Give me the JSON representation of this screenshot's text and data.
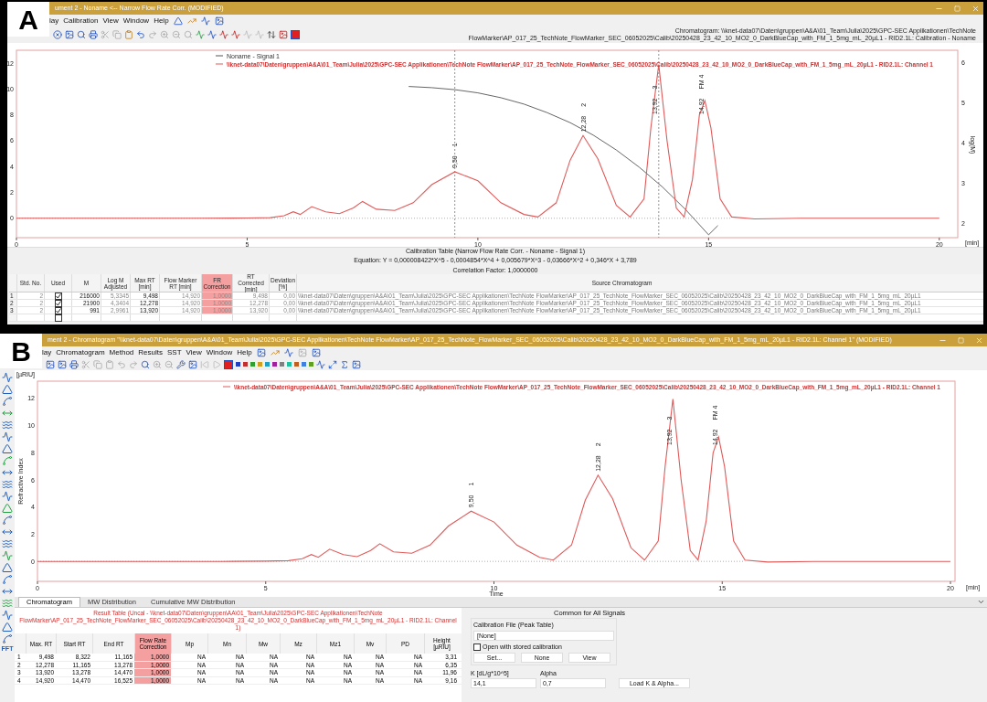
{
  "panel_a": {
    "label": "A",
    "title": "ument 2 -    Noname <-- Narrow Flow Rate Corr.  (MODIFIED)",
    "menu": [
      "lay",
      "Calibration",
      "View",
      "Window",
      "Help"
    ],
    "chart_caption": "Chromatogram: \\\\knet-data07\\Daten\\gruppen\\A&A\\01_Team\\Julia\\2025\\GPC-SEC Applikationen\\TechNote FlowMarker\\AP_017_25_TechNote_FlowMarker_SEC_06052025\\Calib\\20250428_23_42_10_MO2_0_DarkBlueCap_with_FM_1_5mg_mL_20µL1 - RID2.1L: Calibration - Noname",
    "chart_data": {
      "type": "line",
      "xlim": [
        0,
        20.4
      ],
      "ylim": [
        -1.5,
        13
      ],
      "y2lim": [
        1.65,
        6.31
      ],
      "xlabel": "[min]",
      "y2label": "log(M)",
      "xticks": [
        0,
        5,
        10,
        15,
        20
      ],
      "yticks": [
        0,
        2,
        4,
        6,
        8,
        10,
        12
      ],
      "y2ticks": [
        2,
        3,
        4,
        5,
        6
      ],
      "series": [
        {
          "name": "Noname - Signal 1",
          "color": "#555555",
          "axis": "y2",
          "x": [
            8.5,
            9,
            9.5,
            10,
            10.5,
            11,
            11.5,
            12,
            12.5,
            13,
            13.5,
            14,
            14.5,
            15,
            15.2
          ],
          "values": [
            5.41,
            5.38,
            5.33,
            5.25,
            5.13,
            4.97,
            4.76,
            4.51,
            4.2,
            3.83,
            3.4,
            2.91,
            2.35,
            1.72,
            1.95
          ]
        },
        {
          "name": "\\\\knet-data07\\Daten\\gruppen\\A&A\\01_Team\\Julia\\2025\\GPC-SEC Applikationen\\TechNote FlowMarker\\AP_017_25_TechNote_FlowMarker_SEC_06052025\\Calib\\20250428_23_42_10_MO2_0_DarkBlueCap_with_FM_1_5mg_mL_20µL1 - RID2.1L: Channel 1",
          "color": "#e05a5a",
          "x": [
            0,
            1,
            2,
            3,
            4,
            5,
            5.5,
            5.8,
            6,
            6.15,
            6.4,
            6.7,
            7,
            7.3,
            7.5,
            7.8,
            8.2,
            8.6,
            9,
            9.5,
            10,
            10.5,
            11,
            11.3,
            11.7,
            12,
            12.28,
            12.6,
            13,
            13.3,
            13.6,
            13.75,
            13.92,
            14.1,
            14.3,
            14.47,
            14.65,
            14.8,
            14.92,
            15.05,
            15.25,
            15.5,
            16,
            17,
            18,
            19,
            20
          ],
          "values": [
            0,
            0,
            0,
            0,
            0,
            0.02,
            0.05,
            0.2,
            0.5,
            0.3,
            0.9,
            0.5,
            0.35,
            0.8,
            1.3,
            0.7,
            0.6,
            1.2,
            2.6,
            3.6,
            2.9,
            1.2,
            0.3,
            0.1,
            1.2,
            4.5,
            6.4,
            4.6,
            1,
            0.1,
            1.5,
            7,
            11.9,
            6,
            0.8,
            0.1,
            3,
            8,
            9.1,
            7,
            1.5,
            0.1,
            -0.05,
            0,
            0,
            0,
            0
          ]
        }
      ],
      "annotations": [
        "9,50",
        "1",
        "12,28",
        "2",
        "13,92",
        "3",
        "14,92",
        "FM 4"
      ],
      "legend": "upper center",
      "ref_lines": [
        {
          "axis": "x",
          "value": 9.5
        },
        {
          "axis": "x",
          "value": 13.92
        }
      ]
    },
    "calibration": {
      "title": "Calibration Table (Narrow Flow Rate Corr. - Noname - Signal 1)",
      "equation": "Equation: Y = 0,000008422*X^5 - 0,0004854*X^4 + 0,005679*X^3 - 0,03666*X^2 + 0,346*X + 3,789",
      "correlation": "Correlation Factor: 1,0000000"
    },
    "table": {
      "columns": [
        "Std. No.",
        "Used",
        "M",
        "Log M Adjusted",
        "Max RT [min]",
        "Flow Marker RT [min]",
        "FR Correction",
        "RT Corrected [min]",
        "Deviation [%]",
        "Source Chromatogram"
      ],
      "rows": [
        {
          "index": "1",
          "std_no": "2",
          "used": true,
          "m": "216000",
          "log_m": "5,3345",
          "max_rt": "9,498",
          "fm_rt": "14,920",
          "fr": "1,0000",
          "rt_corr": "9,498",
          "dev": "0,00",
          "source": "\\\\knet-data07\\Daten\\gruppen\\A&A\\01_Team\\Julia\\2025\\GPC-SEC Applikationen\\TechNote FlowMarker\\AP_017_25_TechNote_FlowMarker_SEC_06052025\\Calib\\20250428_23_42_10_MO2_0_DarkBlueCap_with_FM_1_5mg_mL_20µL1"
        },
        {
          "index": "2",
          "std_no": "2",
          "used": true,
          "m": "21900",
          "log_m": "4,3404",
          "max_rt": "12,278",
          "fm_rt": "14,920",
          "fr": "1,0000",
          "rt_corr": "12,278",
          "dev": "0,00",
          "source": "\\\\knet-data07\\Daten\\gruppen\\A&A\\01_Team\\Julia\\2025\\GPC-SEC Applikationen\\TechNote FlowMarker\\AP_017_25_TechNote_FlowMarker_SEC_06052025\\Calib\\20250428_23_42_10_MO2_0_DarkBlueCap_with_FM_1_5mg_mL_20µL1"
        },
        {
          "index": "3",
          "std_no": "2",
          "used": true,
          "m": "991",
          "log_m": "2,9961",
          "max_rt": "13,920",
          "fm_rt": "14,920",
          "fr": "1,0000",
          "rt_corr": "13,920",
          "dev": "0,00",
          "source": "\\\\knet-data07\\Daten\\gruppen\\A&A\\01_Team\\Julia\\2025\\GPC-SEC Applikationen\\TechNote FlowMarker\\AP_017_25_TechNote_FlowMarker_SEC_06052025\\Calib\\20250428_23_42_10_MO2_0_DarkBlueCap_with_FM_1_5mg_mL_20µL1"
        },
        {
          "used": false
        }
      ]
    }
  },
  "panel_b": {
    "label": "B",
    "title": "ment 2 - Chromatogram \"\\\\knet-data07\\Daten\\gruppen\\A&A\\01_Team\\Julia\\2025\\GPC-SEC Applikationen\\TechNote FlowMarker\\AP_017_25_TechNote_FlowMarker_SEC_06052025\\Calib\\20250428_23_42_10_MO2_0_DarkBlueCap_with_FM_1_5mg_mL_20µL1 - RID2.1L: Channel 1\" (MODIFIED)",
    "menu": [
      "lay",
      "Chromatogram",
      "Method",
      "Results",
      "SST",
      "View",
      "Window",
      "Help"
    ],
    "tool_strip_label": "FFT",
    "y_unit": "[µRIU]",
    "x_unit": "[min]",
    "chart_data": {
      "type": "line",
      "xlim": [
        0,
        20.1
      ],
      "ylim": [
        -1.47,
        13.27
      ],
      "xlabel": "Time",
      "ylabel": "Refractive Index",
      "xticks": [
        0,
        5,
        10,
        15,
        20
      ],
      "yticks": [
        0,
        2,
        4,
        6,
        8,
        10,
        12
      ],
      "series": [
        {
          "name": "\\\\knet-data07\\Daten\\gruppen\\A&A\\01_Team\\Julia\\2025\\GPC-SEC Applikationen\\TechNote FlowMarker\\AP_017_25_TechNote_FlowMarker_SEC_06052025\\Calib\\20250428_23_42_10_MO2_0_DarkBlueCap_with_FM_1_5mg_mL_20µL1 - RID2.1L: Channel 1",
          "color": "#e05a5a",
          "x": [
            0,
            1,
            2,
            3,
            4,
            5,
            5.5,
            5.8,
            6,
            6.15,
            6.4,
            6.7,
            7,
            7.3,
            7.5,
            7.8,
            8.2,
            8.6,
            9,
            9.5,
            10,
            10.5,
            11,
            11.3,
            11.7,
            12,
            12.28,
            12.6,
            13,
            13.3,
            13.6,
            13.75,
            13.92,
            14.1,
            14.3,
            14.47,
            14.65,
            14.8,
            14.92,
            15.05,
            15.25,
            15.5,
            16,
            17,
            18,
            19,
            20
          ],
          "values": [
            0,
            0,
            0,
            0,
            0,
            0.02,
            0.05,
            0.2,
            0.5,
            0.3,
            0.9,
            0.5,
            0.35,
            0.8,
            1.3,
            0.7,
            0.6,
            1.2,
            2.6,
            3.7,
            2.9,
            1.2,
            0.3,
            0.1,
            1.2,
            4.5,
            6.35,
            4.6,
            1,
            0.1,
            1.5,
            7,
            11.96,
            6,
            0.8,
            0.1,
            3,
            8,
            9.16,
            7,
            1.5,
            0.1,
            -0.05,
            0,
            0,
            0,
            0
          ]
        }
      ],
      "annotations": [
        "9,50",
        "1",
        "12,28",
        "2",
        "13,92",
        "3",
        "14,92",
        "FM 4"
      ],
      "legend": "upper center"
    },
    "tabs": [
      {
        "label": "Chromatogram",
        "selected": true
      },
      {
        "label": "MW Distribution",
        "selected": false
      },
      {
        "label": "Cumulative MW Distribution",
        "selected": false
      }
    ],
    "result_table": {
      "title": "Result Table (Uncal - \\\\knet-data07\\Daten\\gruppen\\AA\\01_Team\\Julia\\2025\\GPC-SEC Applikationen\\TechNote FlowMarker\\AP_017_25_TechNote_FlowMarker_SEC_06052025\\Calib\\20250428_23_42_10_MO2_0_DarkBlueCap_with_FM_1_5mg_mL_20µL1 - RID2.1L: Channel 1)",
      "columns": [
        "Max. RT",
        "Start RT",
        "End RT",
        "Flow Rate Correction",
        "Mp",
        "Mn",
        "Mw",
        "Mz",
        "Mz1",
        "Mv",
        "PD",
        "Height [µRIU]"
      ],
      "rows": [
        {
          "index": "1",
          "cells": [
            "9,498",
            "8,322",
            "11,165",
            "1,0000",
            "NA",
            "NA",
            "NA",
            "NA",
            "NA",
            "NA",
            "NA",
            "3,31"
          ]
        },
        {
          "index": "2",
          "cells": [
            "12,278",
            "11,165",
            "13,278",
            "1,0000",
            "NA",
            "NA",
            "NA",
            "NA",
            "NA",
            "NA",
            "NA",
            "6,35"
          ]
        },
        {
          "index": "3",
          "cells": [
            "13,920",
            "13,278",
            "14,470",
            "1,0000",
            "NA",
            "NA",
            "NA",
            "NA",
            "NA",
            "NA",
            "NA",
            "11,96"
          ]
        },
        {
          "index": "4",
          "cells": [
            "14,920",
            "14,470",
            "16,525",
            "1,0000",
            "NA",
            "NA",
            "NA",
            "NA",
            "NA",
            "NA",
            "NA",
            "9,16"
          ]
        }
      ]
    },
    "signals": {
      "title": "Common for All Signals",
      "group": "Calibration File (Peak Table)",
      "file": "[None]",
      "open_stored": {
        "label": "Open with stored calibration",
        "checked": false
      },
      "buttons": [
        "Set...",
        "None",
        "View"
      ],
      "k_label": "K [dL/g*10^5]",
      "k_value": "14,1",
      "alpha_label": "Alpha",
      "alpha_value": "0,7",
      "load_button": "Load K & Alpha..."
    }
  }
}
